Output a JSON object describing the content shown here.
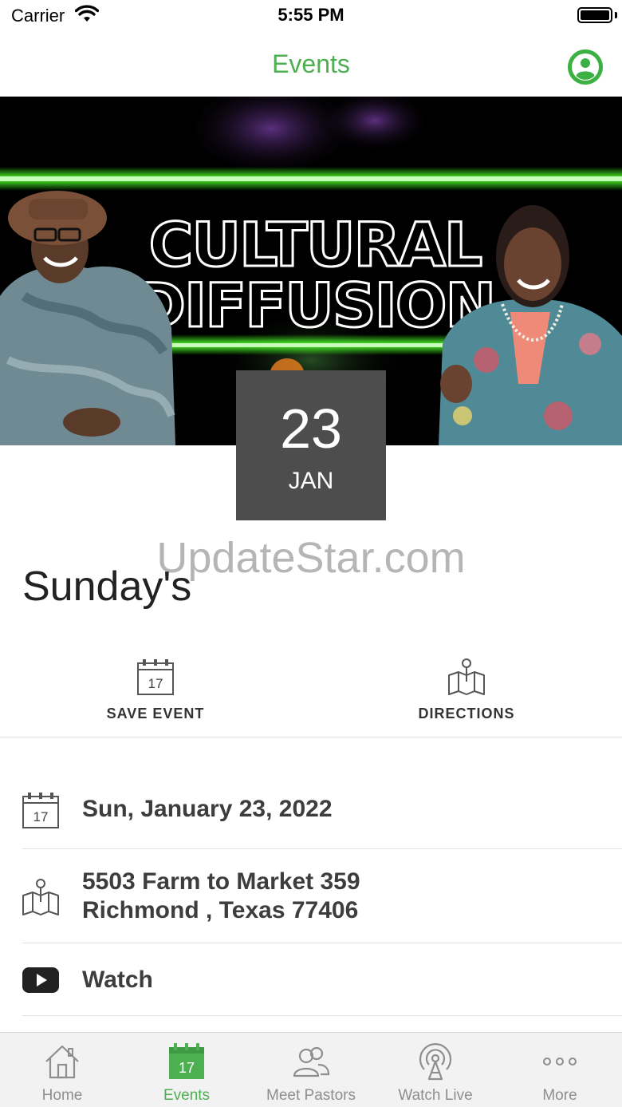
{
  "status_bar": {
    "carrier": "Carrier",
    "time": "5:55 PM"
  },
  "nav": {
    "title": "Events",
    "profile_icon": "user-circle-icon"
  },
  "banner": {
    "line1": "CULTURAL",
    "line2": "DIFFUSION"
  },
  "event": {
    "day": "23",
    "month": "JAN",
    "title": "Sunday's"
  },
  "watermark": "UpdateStar.com",
  "actions": {
    "save_event": "SAVE EVENT",
    "directions": "DIRECTIONS"
  },
  "details": {
    "date_icon_day": "17",
    "date": "Sun, January 23, 2022",
    "address_line1": "5503 Farm to Market 359",
    "address_line2": "Richmond , Texas 77406",
    "watch": "Watch"
  },
  "tab_bar": {
    "tabs": [
      {
        "label": "Home",
        "icon": "home-icon"
      },
      {
        "label": "Events",
        "icon": "calendar-icon",
        "icon_day": "17"
      },
      {
        "label": "Meet Pastors",
        "icon": "people-icon"
      },
      {
        "label": "Watch Live",
        "icon": "broadcast-icon"
      },
      {
        "label": "More",
        "icon": "more-dots-icon"
      }
    ],
    "active_index": 1
  },
  "colors": {
    "accent": "#4caf50",
    "badge": "#4d4d4d",
    "tab_inactive": "#8e8e8e"
  }
}
